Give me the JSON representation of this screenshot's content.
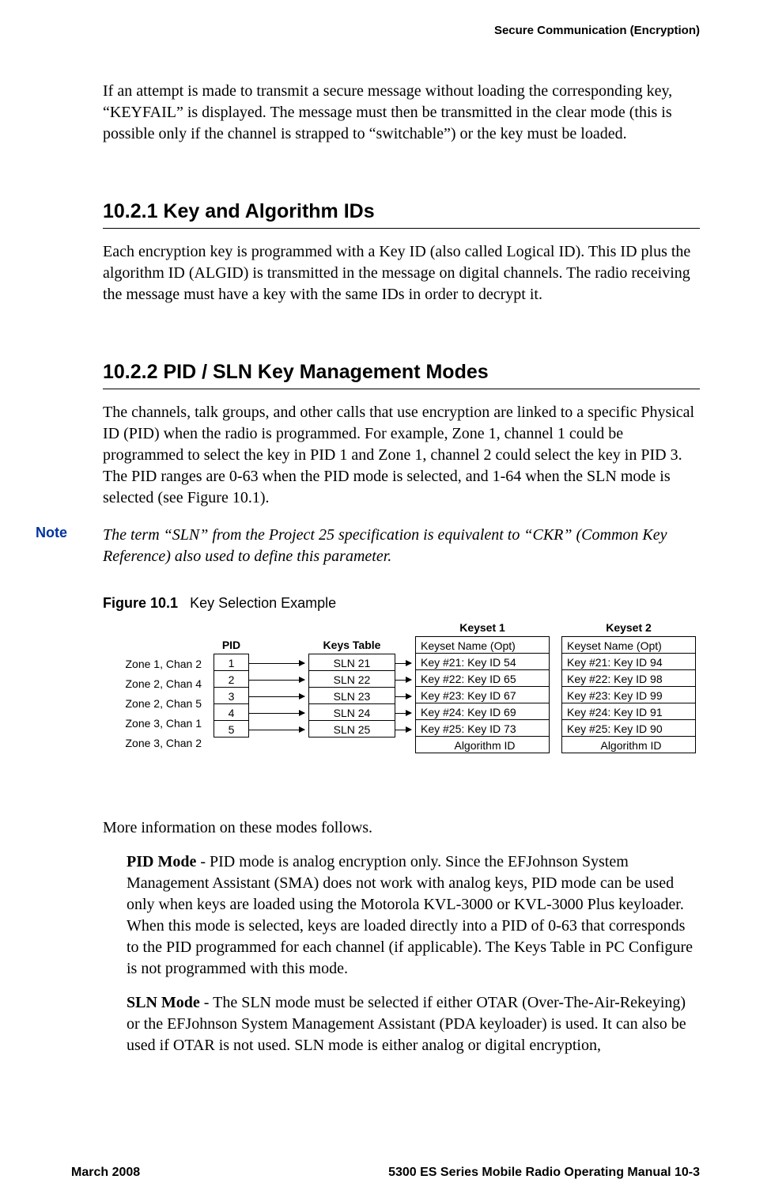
{
  "running_header": "Secure Communication (Encryption)",
  "intro_para": "If an attempt is made to transmit a secure message without loading the corresponding key, “KEYFAIL” is displayed. The message must then be transmitted in the clear mode (this is possible only if the channel is strapped to “switchable”) or the key must be loaded.",
  "sec1": {
    "heading": "10.2.1   Key and Algorithm IDs",
    "para": "Each encryption key is programmed with a Key ID (also called Logical ID). This ID plus the algorithm ID (ALGID) is transmitted in the message on digital channels. The radio receiving the message must have a key with the same IDs in order to decrypt it."
  },
  "sec2": {
    "heading": "10.2.2   PID / SLN Key Management Modes",
    "para": "The channels, talk groups, and other calls that use encryption are linked to a specific Physical ID (PID) when the radio is programmed. For example, Zone 1, channel 1 could be programmed to select the key in PID 1 and Zone 1, channel 2 could select the key in PID 3. The PID ranges are 0-63 when the PID mode is selected, and 1-64 when the SLN mode is selected (see Figure 10.1)."
  },
  "note": {
    "label": "Note",
    "body": "The term “SLN” from the Project 25 specification is equivalent to “CKR” (Common Key Reference) also used to define this parameter."
  },
  "figure": {
    "label": "Figure 10.1",
    "title": "Key Selection Example",
    "headers": {
      "pid": "PID",
      "keys_table": "Keys Table",
      "keyset1": "Keyset 1",
      "keyset2": "Keyset 2",
      "keyset_name_opt": "Keyset Name (Opt)",
      "algorithm_id": "Algorithm ID"
    },
    "rows": [
      {
        "zone": "Zone 1, Chan 2",
        "pid": "1",
        "sln": "SLN 21",
        "ks1": "Key #21: Key ID 54",
        "ks2": "Key #21: Key ID 94"
      },
      {
        "zone": "Zone 2, Chan 4",
        "pid": "2",
        "sln": "SLN 22",
        "ks1": "Key #22: Key ID 65",
        "ks2": "Key #22: Key ID 98"
      },
      {
        "zone": "Zone 2, Chan 5",
        "pid": "3",
        "sln": "SLN 23",
        "ks1": "Key #23: Key ID 67",
        "ks2": "Key #23: Key ID 99"
      },
      {
        "zone": "Zone 3, Chan 1",
        "pid": "4",
        "sln": "SLN 24",
        "ks1": "Key #24: Key ID 69",
        "ks2": "Key #24: Key ID 91"
      },
      {
        "zone": "Zone 3, Chan 2",
        "pid": "5",
        "sln": "SLN 25",
        "ks1": "Key #25: Key ID 73",
        "ks2": "Key #25: Key ID 90"
      }
    ]
  },
  "after_fig_para": "More information on these modes follows.",
  "pid_mode": {
    "bold": "PID Mode",
    "rest": " - PID mode is analog encryption only. Since the EFJohnson System Management Assistant (SMA) does not work with analog keys, PID mode can be used only when keys are loaded using the Motorola KVL-3000 or KVL-3000 Plus keyloader. When this mode is selected, keys are loaded directly into a PID of 0-63 that corresponds to the PID programmed for each channel (if applicable). The Keys Table in PC Configure is not programmed with this mode."
  },
  "sln_mode": {
    "bold": "SLN Mode",
    "rest": " - The SLN mode must be selected if either OTAR (Over-The-Air-Rekeying) or the EFJohnson System Management Assistant (PDA keyloader) is used. It can also be used if OTAR is not used. SLN mode is either analog or digital encryption,"
  },
  "footer": {
    "left": "March 2008",
    "right": "5300 ES Series Mobile Radio Operating Manual    10-3"
  }
}
